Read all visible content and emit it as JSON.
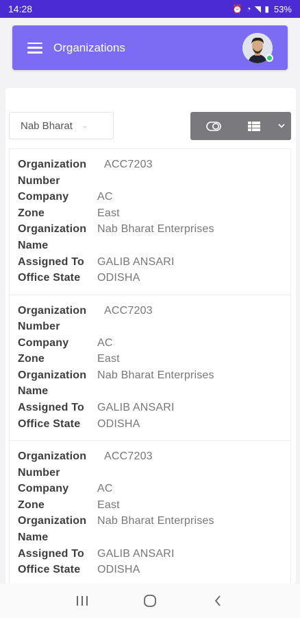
{
  "status_bar": {
    "time": "14:28",
    "battery": "53%",
    "icons": "⏰ ◔ ◥ ▮"
  },
  "header": {
    "title": "Organizations"
  },
  "filter": {
    "selected": "Nab Bharat"
  },
  "organizations": [
    {
      "number_label": "Organization",
      "number_label2": "Number",
      "number": "ACC7203",
      "company_label": "Company",
      "company": "AC",
      "zone_label": "Zone",
      "zone": "East",
      "name_label": "Organization",
      "name_label2": "Name",
      "name": "Nab Bharat Enterprises",
      "assigned_label": "Assigned To",
      "assigned": "GALIB ANSARI",
      "state_label": "Office State",
      "state": "ODISHA"
    },
    {
      "number_label": "Organization",
      "number_label2": "Number",
      "number": "ACC7203",
      "company_label": "Company",
      "company": "AC",
      "zone_label": "Zone",
      "zone": "East",
      "name_label": "Organization",
      "name_label2": "Name",
      "name": "Nab Bharat Enterprises",
      "assigned_label": "Assigned To",
      "assigned": "GALIB ANSARI",
      "state_label": "Office State",
      "state": "ODISHA"
    },
    {
      "number_label": "Organization",
      "number_label2": "Number",
      "number": "ACC7203",
      "company_label": "Company",
      "company": "AC",
      "zone_label": "Zone",
      "zone": "East",
      "name_label": "Organization",
      "name_label2": "Name",
      "name": "Nab Bharat Enterprises",
      "assigned_label": "Assigned To",
      "assigned": "GALIB ANSARI",
      "state_label": "Office State",
      "state": "ODISHA"
    }
  ],
  "colors": {
    "status_bar": "#4a2bd4",
    "header": "#7b6cf3",
    "toggle": "#7a7a7e",
    "online": "#2ecc71"
  }
}
